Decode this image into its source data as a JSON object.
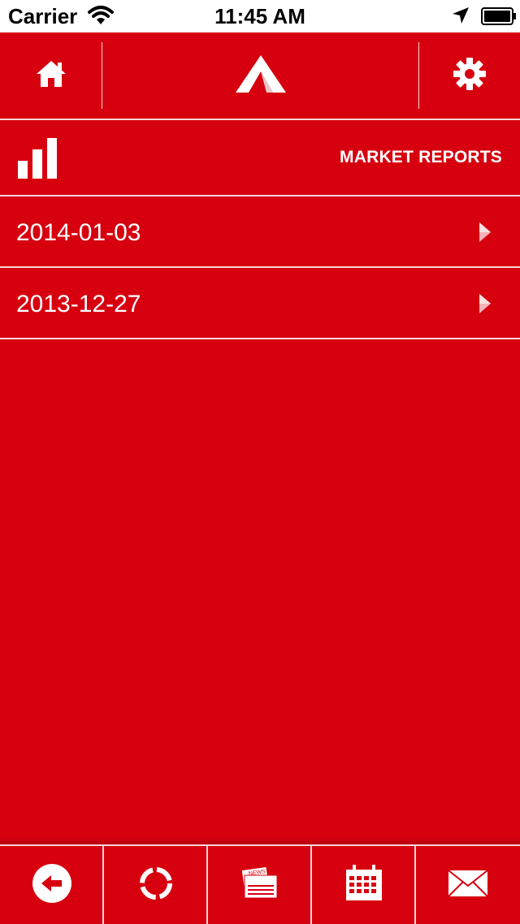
{
  "status_bar": {
    "carrier": "Carrier",
    "time": "11:45 AM"
  },
  "header": {
    "section_title": "MARKET REPORTS"
  },
  "reports": [
    {
      "date": "2014-01-03"
    },
    {
      "date": "2013-12-27"
    }
  ],
  "bottom_nav": {
    "news_label": "NEWS"
  },
  "colors": {
    "accent_red": "#d6000f",
    "separator": "#f4d6d8",
    "text": "#ffffff"
  }
}
